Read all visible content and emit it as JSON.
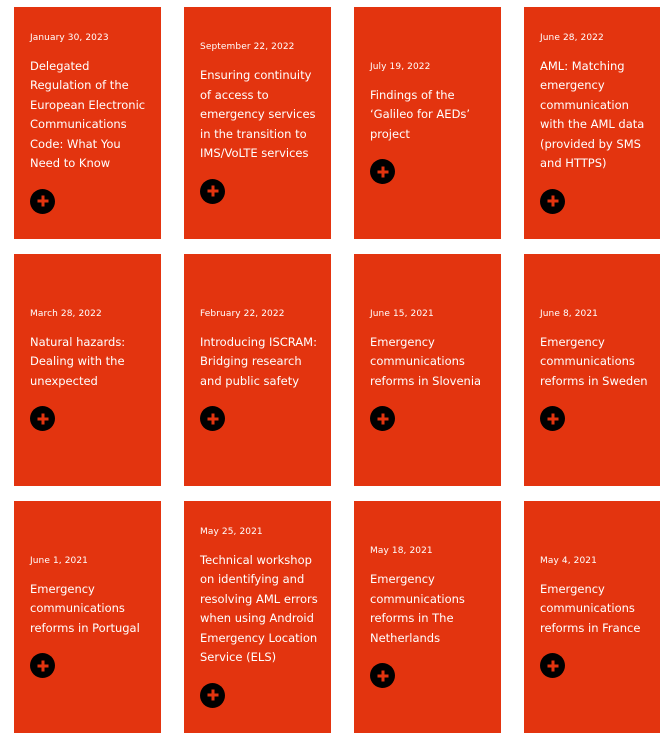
{
  "accent_color": "#e3340f",
  "cards": [
    {
      "date": "January 30, 2023",
      "title": "Delegated Regulation of the European Electronic Communications Code: What You Need to Know",
      "icon": "plus-icon"
    },
    {
      "date": "September 22, 2022",
      "title": "Ensuring continuity of access to emergency services in the transition to IMS/VoLTE services",
      "icon": "plus-icon"
    },
    {
      "date": "July 19, 2022",
      "title": "Findings of the ‘Galileo for AEDs’ project",
      "icon": "plus-icon"
    },
    {
      "date": "June 28, 2022",
      "title": "AML: Matching emergency communication with the AML data (provided by SMS and HTTPS)",
      "icon": "plus-icon"
    },
    {
      "date": "March 28, 2022",
      "title": "Natural hazards: Dealing with the unexpected",
      "icon": "plus-icon"
    },
    {
      "date": "February 22, 2022",
      "title": "Introducing ISCRAM: Bridging research and public safety",
      "icon": "plus-icon"
    },
    {
      "date": "June 15, 2021",
      "title": "Emergency communications reforms in Slovenia",
      "icon": "plus-icon"
    },
    {
      "date": "June 8, 2021",
      "title": "Emergency communications reforms in Sweden",
      "icon": "plus-icon"
    },
    {
      "date": "June 1, 2021",
      "title": "Emergency communications reforms in Portugal",
      "icon": "plus-icon"
    },
    {
      "date": "May 25, 2021",
      "title": "Technical workshop on identifying and resolving AML errors when using Android Emergency Location Service (ELS)",
      "icon": "plus-icon"
    },
    {
      "date": "May 18, 2021",
      "title": "Emergency communications reforms in The Netherlands",
      "icon": "plus-icon"
    },
    {
      "date": "May 4, 2021",
      "title": "Emergency communications reforms in France",
      "icon": "plus-icon"
    }
  ]
}
